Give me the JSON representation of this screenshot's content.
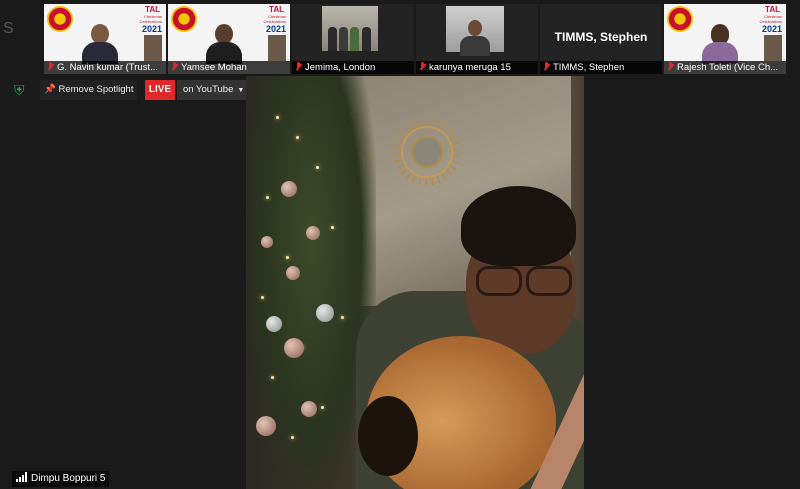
{
  "participants": [
    {
      "name": "G. Navin kumar (Trust...",
      "type": "banner",
      "banner": {
        "title": "TAL",
        "subtitle": "Christmas Celebrations",
        "year": "2021"
      }
    },
    {
      "name": "Yamsee Mohan",
      "type": "banner",
      "banner": {
        "title": "TAL",
        "subtitle": "Christmas Celebrations",
        "year": "2021"
      }
    },
    {
      "name": "Jemima, London",
      "type": "group"
    },
    {
      "name": "karunya meruga 15",
      "type": "person"
    },
    {
      "name": "TIMMS, Stephen",
      "type": "nameonly",
      "title": "TIMMS, Stephen"
    },
    {
      "name": "Rajesh Toleti (Vice Ch...",
      "type": "banner",
      "banner": {
        "title": "TAL",
        "subtitle": "Christmas Celebrations",
        "year": "2021"
      }
    }
  ],
  "controls": {
    "remove_spotlight": "Remove Spotlight",
    "live_badge": "LIVE",
    "live_platform": "on YouTube"
  },
  "active_speaker": {
    "name": "Dimpu Boppuri 5"
  },
  "colors": {
    "live_red": "#e02828",
    "security_green": "#1aa64a",
    "muted_red": "#e02828"
  }
}
